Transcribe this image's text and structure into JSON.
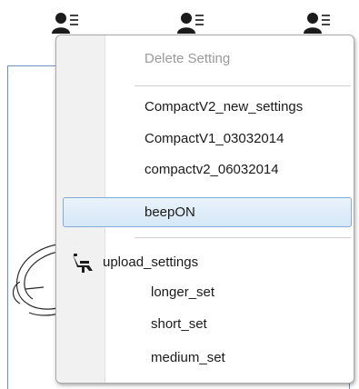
{
  "toolbar": {
    "icons": [
      "user-list-icon",
      "user-list-icon",
      "user-list-icon"
    ]
  },
  "menu": {
    "header_item": "Delete Setting",
    "settings_items": [
      "CompactV2_new_settings",
      "CompactV1_03032014",
      "compactv2_06032014"
    ],
    "selected_item": "beepON",
    "submenu": {
      "label": "upload_settings",
      "icon": "dental-chair-icon",
      "items": [
        "longer_set",
        "short_set",
        "medium_set"
      ]
    }
  },
  "colors": {
    "highlight_border": "#84acd6",
    "highlight_fill": "#dcebf8",
    "disabled_text": "#9a9a9a",
    "accent_line": "#6f8fc0"
  }
}
